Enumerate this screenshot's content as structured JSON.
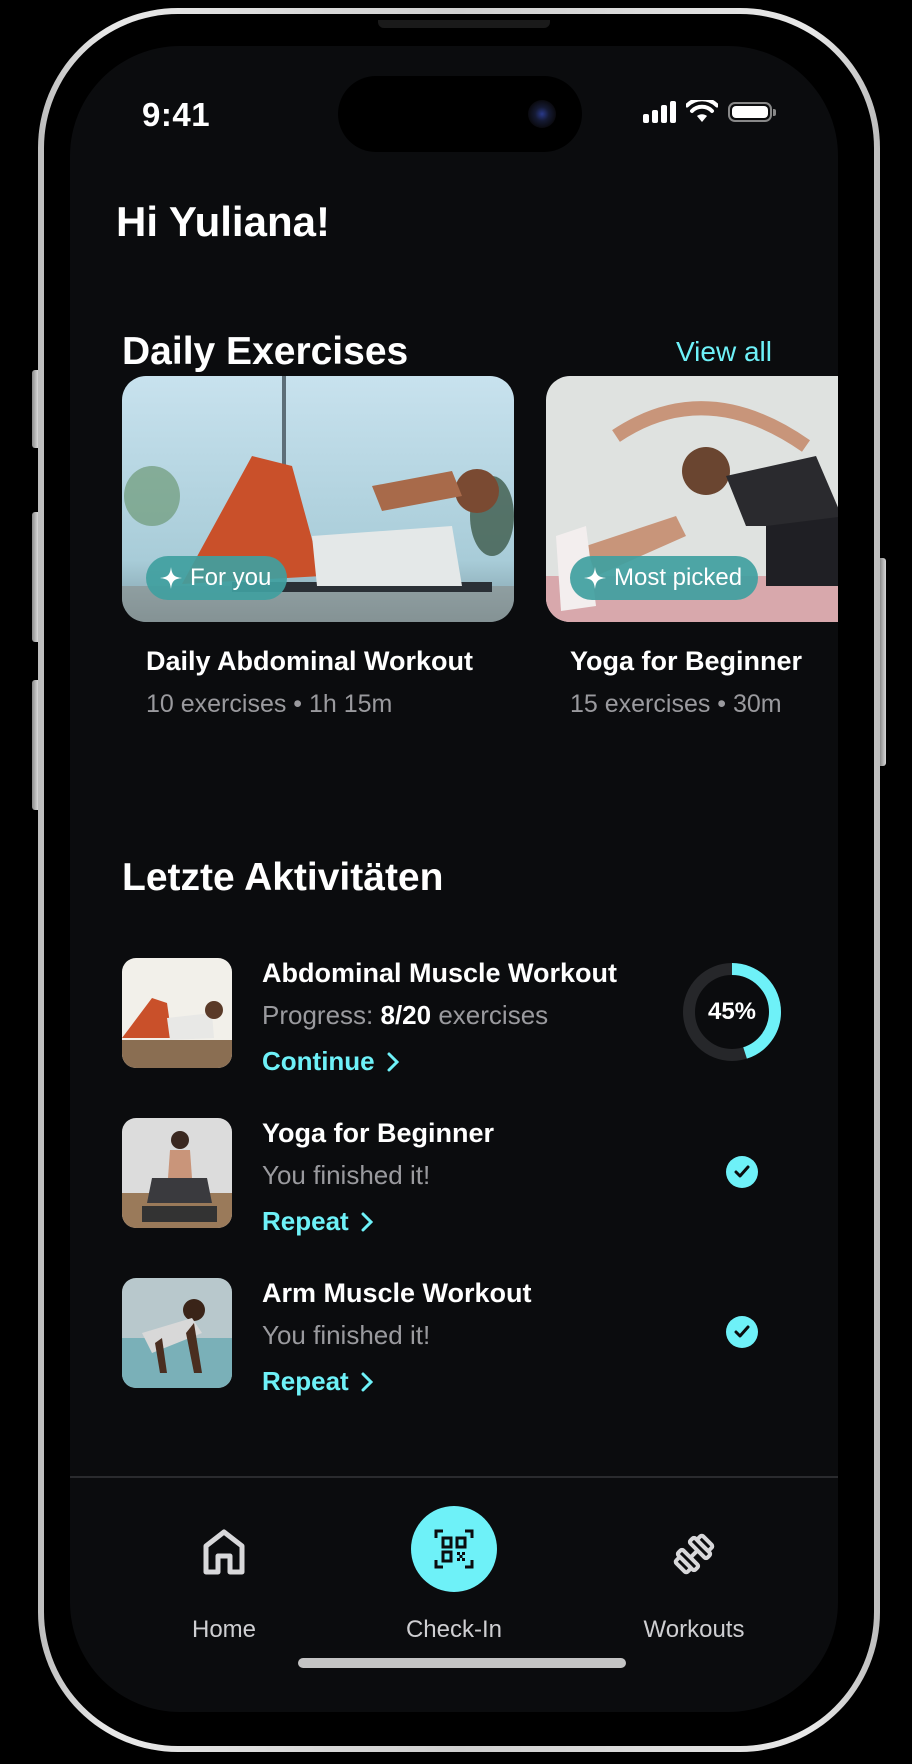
{
  "status_bar": {
    "time": "9:41"
  },
  "greeting": "Hi Yuliana!",
  "daily_exercises": {
    "title": "Daily Exercises",
    "view_all_label": "View all",
    "cards": [
      {
        "badge": "For you",
        "title": "Daily Abdominal Workout",
        "subtitle": "10 exercises • 1h 15m"
      },
      {
        "badge": "Most picked",
        "title": "Yoga for Beginner",
        "subtitle": "15 exercises • 30m"
      }
    ]
  },
  "recent_activities": {
    "title": "Letzte Aktivitäten",
    "items": [
      {
        "title": "Abdominal Muscle Workout",
        "progress_label": "Progress:",
        "progress_value": "8/20",
        "progress_suffix": "exercises",
        "link": "Continue",
        "percent": 45,
        "percent_label": "45%"
      },
      {
        "title": "Yoga for Beginner",
        "subtitle": "You finished it!",
        "link": "Repeat",
        "status": "completed"
      },
      {
        "title": "Arm Muscle Workout",
        "subtitle": "You finished it!",
        "link": "Repeat",
        "status": "completed"
      }
    ]
  },
  "tab_bar": {
    "tabs": [
      {
        "label": "Home",
        "icon": "home-icon"
      },
      {
        "label": "Check-In",
        "icon": "qr-code-icon"
      },
      {
        "label": "Workouts",
        "icon": "dumbbell-icon"
      }
    ]
  },
  "colors": {
    "accent": "#6ef1f8",
    "badge": "#40a0a0",
    "background": "#0b0c0e",
    "muted_text": "#9a9a9e"
  }
}
